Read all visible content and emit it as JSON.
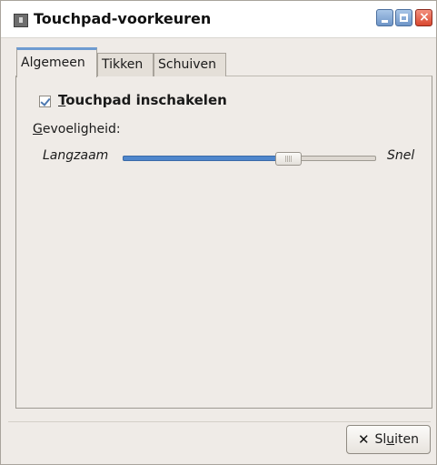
{
  "window": {
    "title": "Touchpad-voorkeuren",
    "icon": "touchpad-app-icon",
    "minimize_icon": "minimize-icon",
    "maximize_icon": "maximize-icon",
    "close_icon": "close-icon",
    "close_glyph": "×"
  },
  "tabs": [
    {
      "label": "Algemeen",
      "active": true
    },
    {
      "label": "Tikken",
      "active": false
    },
    {
      "label": "Schuiven",
      "active": false
    }
  ],
  "general": {
    "enable_touchpad": {
      "label_underlined": "T",
      "label_rest": "ouchpad inschakelen",
      "checked": true
    },
    "sensitivity": {
      "label_underlined": "G",
      "label_rest": "evoeligheid:",
      "min_label": "Langzaam",
      "max_label": "Snel",
      "value_fraction": 0.67
    }
  },
  "footer": {
    "close_button": {
      "icon": "x-close-icon",
      "glyph": "✕",
      "pre": "Sl",
      "underlined": "u",
      "post": "iten"
    }
  },
  "colors": {
    "accent": "#4f86cc",
    "tab_active_border": "#6e9bd1",
    "close_btn": "#d9472f"
  }
}
